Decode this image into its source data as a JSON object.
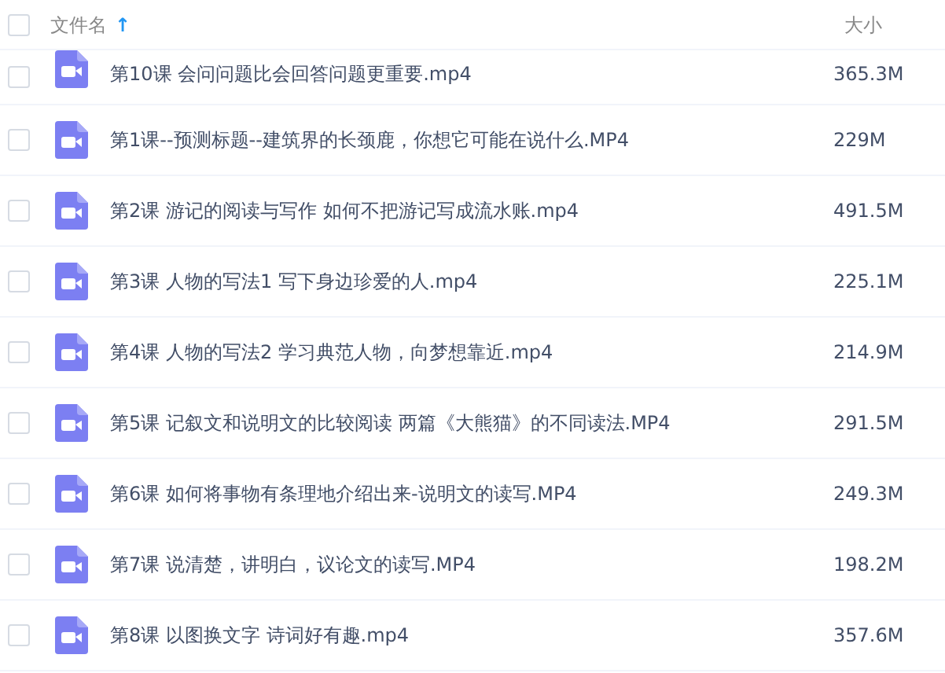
{
  "header": {
    "checked": false,
    "name_column": "文件名",
    "sort_arrow": "↑",
    "size_column": "大小"
  },
  "files": [
    {
      "name": "第10课 会问问题比会回答问题更重要.mp4",
      "size": "365.3M",
      "checked": false
    },
    {
      "name": "第1课--预测标题--建筑界的长颈鹿，你想它可能在说什么.MP4",
      "size": "229M",
      "checked": false
    },
    {
      "name": "第2课 游记的阅读与写作 如何不把游记写成流水账.mp4",
      "size": "491.5M",
      "checked": false
    },
    {
      "name": "第3课 人物的写法1 写下身边珍爱的人.mp4",
      "size": "225.1M",
      "checked": false
    },
    {
      "name": "第4课 人物的写法2 学习典范人物，向梦想靠近.mp4",
      "size": "214.9M",
      "checked": false
    },
    {
      "name": "第5课 记叙文和说明文的比较阅读 两篇《大熊猫》的不同读法.MP4",
      "size": "291.5M",
      "checked": false
    },
    {
      "name": "第6课 如何将事物有条理地介绍出来-说明文的读写.MP4",
      "size": "249.3M",
      "checked": false
    },
    {
      "name": "第7课 说清楚，讲明白，议论文的读写.MP4",
      "size": "198.2M",
      "checked": false
    },
    {
      "name": "第8课 以图换文字 诗词好有趣.mp4",
      "size": "357.6M",
      "checked": false
    }
  ]
}
